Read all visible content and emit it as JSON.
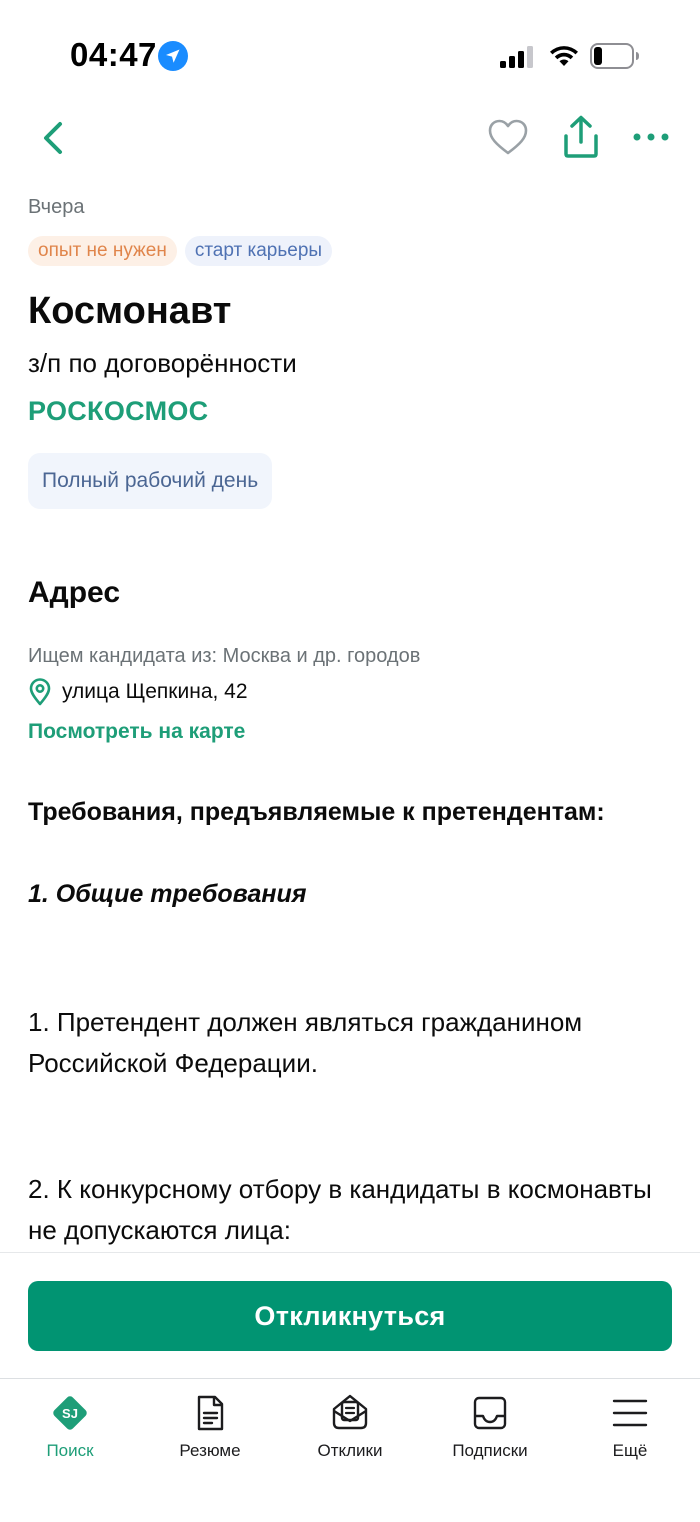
{
  "status_bar": {
    "time": "04:47"
  },
  "vacancy": {
    "posted": "Вчера",
    "tags": [
      "опыт не нужен",
      "старт карьеры"
    ],
    "title": "Космонавт",
    "salary": "з/п по договорённости",
    "company": "РОСКОСМОС",
    "schedule": "Полный рабочий день"
  },
  "address": {
    "heading": "Адрес",
    "candidate_from": "Ищем кандидата из: Москва и др. городов",
    "street": "улица Щепкина, 42",
    "map_link": "Посмотреть на карте"
  },
  "requirements": {
    "heading": "Требования, предъявляемые к претендентам:",
    "subheading": "1. Общие требования",
    "paragraphs": [
      "1. Претендент должен являться гражданином Российской Федерации.",
      "2. К конкурсному отбору в кандидаты в космонавты не допускаются лица:"
    ]
  },
  "actions": {
    "apply_label": "Откликнуться"
  },
  "tab_bar": {
    "items": [
      {
        "label": "Поиск",
        "icon": "sj-logo-icon",
        "active": true
      },
      {
        "label": "Резюме",
        "icon": "resume-icon",
        "active": false
      },
      {
        "label": "Отклики",
        "icon": "responses-icon",
        "active": false
      },
      {
        "label": "Подписки",
        "icon": "inbox-icon",
        "active": false
      },
      {
        "label": "Ещё",
        "icon": "menu-icon",
        "active": false
      }
    ]
  },
  "colors": {
    "accent_green": "#1e9e78",
    "button_green": "#019472",
    "tag_orange_text": "#e0854b",
    "tag_blue_text": "#4f72b3",
    "location_arrow": "#1a8cff"
  }
}
